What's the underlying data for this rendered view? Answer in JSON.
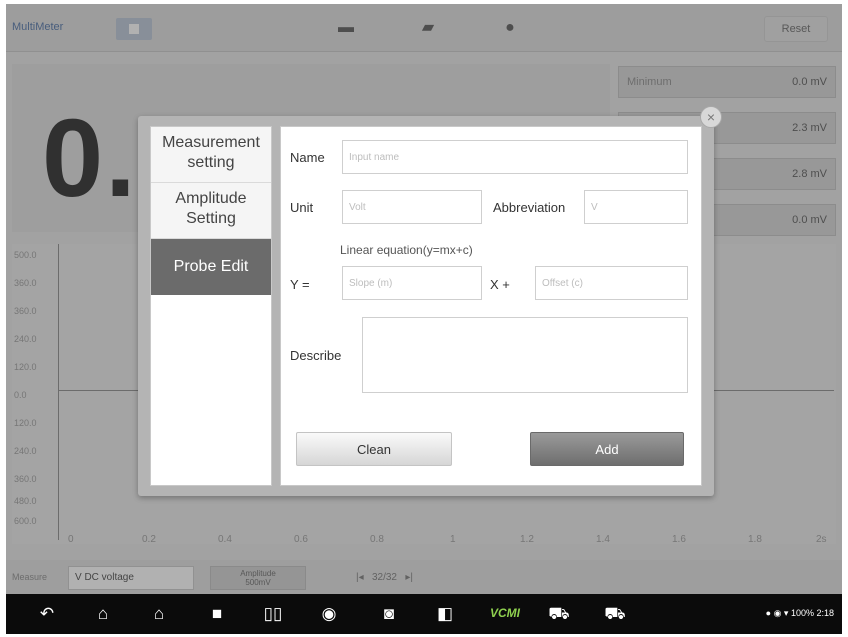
{
  "app": {
    "title": "MultiMeter",
    "reset_label": "Reset",
    "reading": "0.",
    "stats": [
      {
        "label": "Minimum",
        "value": "0.0 mV"
      },
      {
        "label": "",
        "value": "2.3 mV"
      },
      {
        "label": "",
        "value": "2.8 mV"
      },
      {
        "label": "",
        "value": "0.0 mV"
      }
    ],
    "chart": {
      "y_ticks": [
        "500.0",
        "360.0",
        "360.0",
        "240.0",
        "120.0",
        "0.0",
        "120.0",
        "240.0",
        "360.0",
        "480.0",
        "600.0"
      ],
      "x_ticks": [
        "0",
        "0.2",
        "0.4",
        "0.6",
        "0.8",
        "1",
        "1.2",
        "1.4",
        "1.6",
        "1.8",
        "2s"
      ]
    },
    "bottom": {
      "measure_label": "Measure",
      "measure_value": "V  DC voltage",
      "amplitude_label": "Amplitude",
      "amplitude_value": "500mV",
      "pager": "32/32"
    }
  },
  "dialog": {
    "close_glyph": "×",
    "menu": [
      {
        "label": "Measurement setting"
      },
      {
        "label": "Amplitude Setting"
      },
      {
        "label": "Probe Edit",
        "active": true
      }
    ],
    "form": {
      "name_label": "Name",
      "name_placeholder": "Input name",
      "unit_label": "Unit",
      "unit_placeholder": "Volt",
      "abbreviation_label": "Abbreviation",
      "abbreviation_placeholder": "V",
      "equation_caption": "Linear equation(y=mx+c)",
      "y_label": "Y  =",
      "slope_placeholder": "Slope (m)",
      "x_label": "X  +",
      "offset_placeholder": "Offset (c)",
      "describe_label": "Describe",
      "clean_label": "Clean",
      "add_label": "Add"
    }
  },
  "navbar": {
    "vcmi_label": "VCM",
    "vcmi_suffix": "I",
    "status_text": "100% 2:18"
  }
}
